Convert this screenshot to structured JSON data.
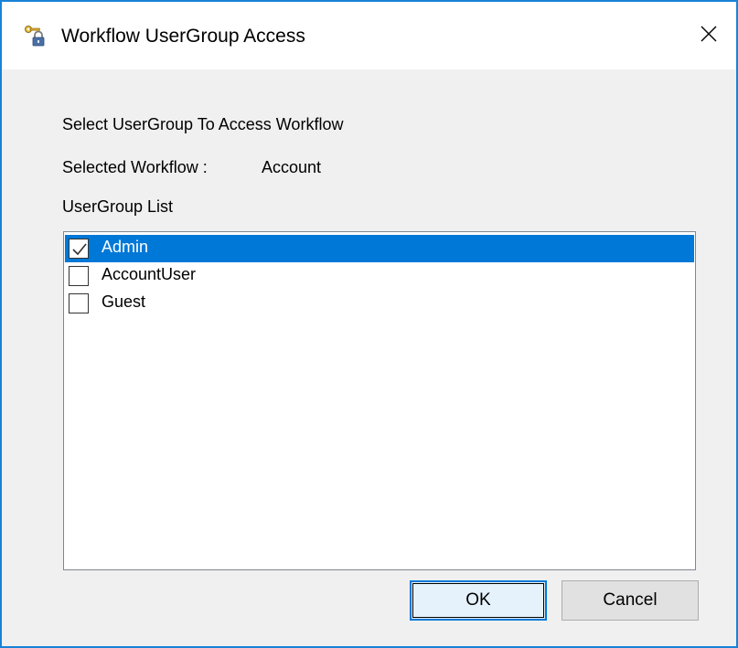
{
  "window": {
    "title": "Workflow UserGroup Access",
    "title_icon": "key-lock-icon",
    "close_icon": "close-icon"
  },
  "form": {
    "instruction": "Select UserGroup To Access Workflow",
    "selected_workflow_label": "Selected Workflow :",
    "selected_workflow_value": "Account",
    "list_label": "UserGroup List"
  },
  "usergroups": [
    {
      "label": "Admin",
      "checked": true,
      "selected": true
    },
    {
      "label": "AccountUser",
      "checked": false,
      "selected": false
    },
    {
      "label": "Guest",
      "checked": false,
      "selected": false
    }
  ],
  "buttons": {
    "ok_label": "OK",
    "cancel_label": "Cancel"
  },
  "colors": {
    "accent": "#0078d7",
    "window_border": "#1883d7",
    "dialog_background": "#f0f0f0"
  }
}
